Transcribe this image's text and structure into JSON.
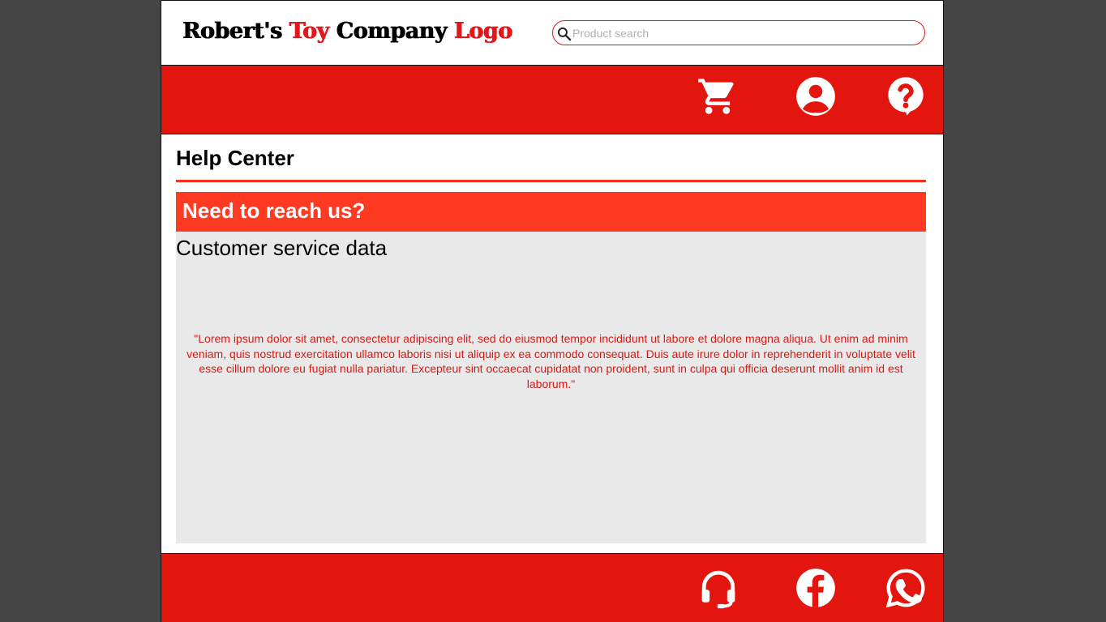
{
  "header": {
    "logo_part1": "Robert's ",
    "logo_part2": "Toy",
    "logo_part3": " Company ",
    "logo_part4": "Logo",
    "search_placeholder": "Product search"
  },
  "nav": {
    "icons": [
      "cart-icon",
      "account-icon",
      "help-icon"
    ]
  },
  "main": {
    "page_title": "Help Center",
    "section_heading": "Need to reach us?",
    "data_title": "Customer service data",
    "lorem": "\"Lorem ipsum dolor sit amet, consectetur adipiscing elit, sed do eiusmod tempor incididunt ut labore et dolore magna aliqua. Ut enim ad minim veniam, quis nostrud exercitation ullamco laboris nisi ut aliquip ex ea commodo consequat. Duis aute irure dolor in reprehenderit in voluptate velit esse cillum dolore eu fugiat nulla pariatur. Excepteur sint occaecat cupidatat non proident, sunt in culpa qui officia deserunt mollit anim id est laborum.\""
  },
  "footer": {
    "icons": [
      "headset-icon",
      "facebook-icon",
      "whatsapp-icon"
    ]
  },
  "colors": {
    "brand_red": "#e3160f",
    "accent_red": "#ff3a22",
    "background_gray": "#454545",
    "panel_gray": "#e9e9e9"
  }
}
